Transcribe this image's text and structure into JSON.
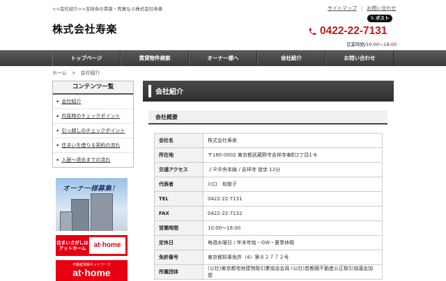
{
  "header": {
    "tagline": "<<会社紹介>>吉祥寺の賃貸・売買なら株式会社寿楽",
    "top_links": [
      "サイトマップ",
      "お問い合わせ"
    ],
    "x_post": "𝕏 ポスト",
    "logo": "株式会社寿楽",
    "phone": "0422-22-7131",
    "hours": "営業時間/10:00～18:00"
  },
  "nav": [
    "トップページ",
    "賃貸物件検索",
    "オーナー様へ",
    "会社紹介",
    "お問い合わせ"
  ],
  "breadcrumb": {
    "home": "ホーム",
    "sep": ">",
    "current": "会社紹介"
  },
  "sidebar": {
    "title": "コンテンツ一覧",
    "items": [
      "会社紹介",
      "内見時のチェックポイント",
      "引っ越しのチェックポイント",
      "住まいを借りる契約の流れ",
      "入居～退去までの流れ"
    ]
  },
  "banners": {
    "owner": "オーナー様募集！",
    "athome_left": "住まいさがしは アットホーム",
    "athome_right": "at·home",
    "athome2_small": "不動産情報ネットワーク",
    "athome2_big": "at·home"
  },
  "main": {
    "title": "会社紹介",
    "section": "会社概要",
    "rows": [
      {
        "k": "会社名",
        "v": "株式会社寿楽"
      },
      {
        "k": "所在地",
        "v": "〒180-0002 東京都武蔵野市吉祥寺東町2丁目1-6"
      },
      {
        "k": "交通アクセス",
        "v": "ＪＲ中央本線 / 吉祥寺 徒歩 12分"
      },
      {
        "k": "代表者",
        "v": "川口　和歌子"
      },
      {
        "k": "TEL",
        "v": "0422-22-7131"
      },
      {
        "k": "FAX",
        "v": "0422-22-7132"
      },
      {
        "k": "営業時間",
        "v": "10:00～18:00"
      },
      {
        "k": "定休日",
        "v": "毎週水曜日 / 年末年始・GW・夏季休暇"
      },
      {
        "k": "免許番号",
        "v": "東京都知事免許（4）第８２７７２号"
      },
      {
        "k": "所属団体",
        "v": "(公社)東京都宅地建物取引業協会会員 (公社)首都圏不動産公正取引協議会加盟"
      }
    ]
  },
  "colors": {
    "accent_red": "#c9161d",
    "athome_red": "#e60012",
    "nav_dark": "#3a3a3a"
  }
}
